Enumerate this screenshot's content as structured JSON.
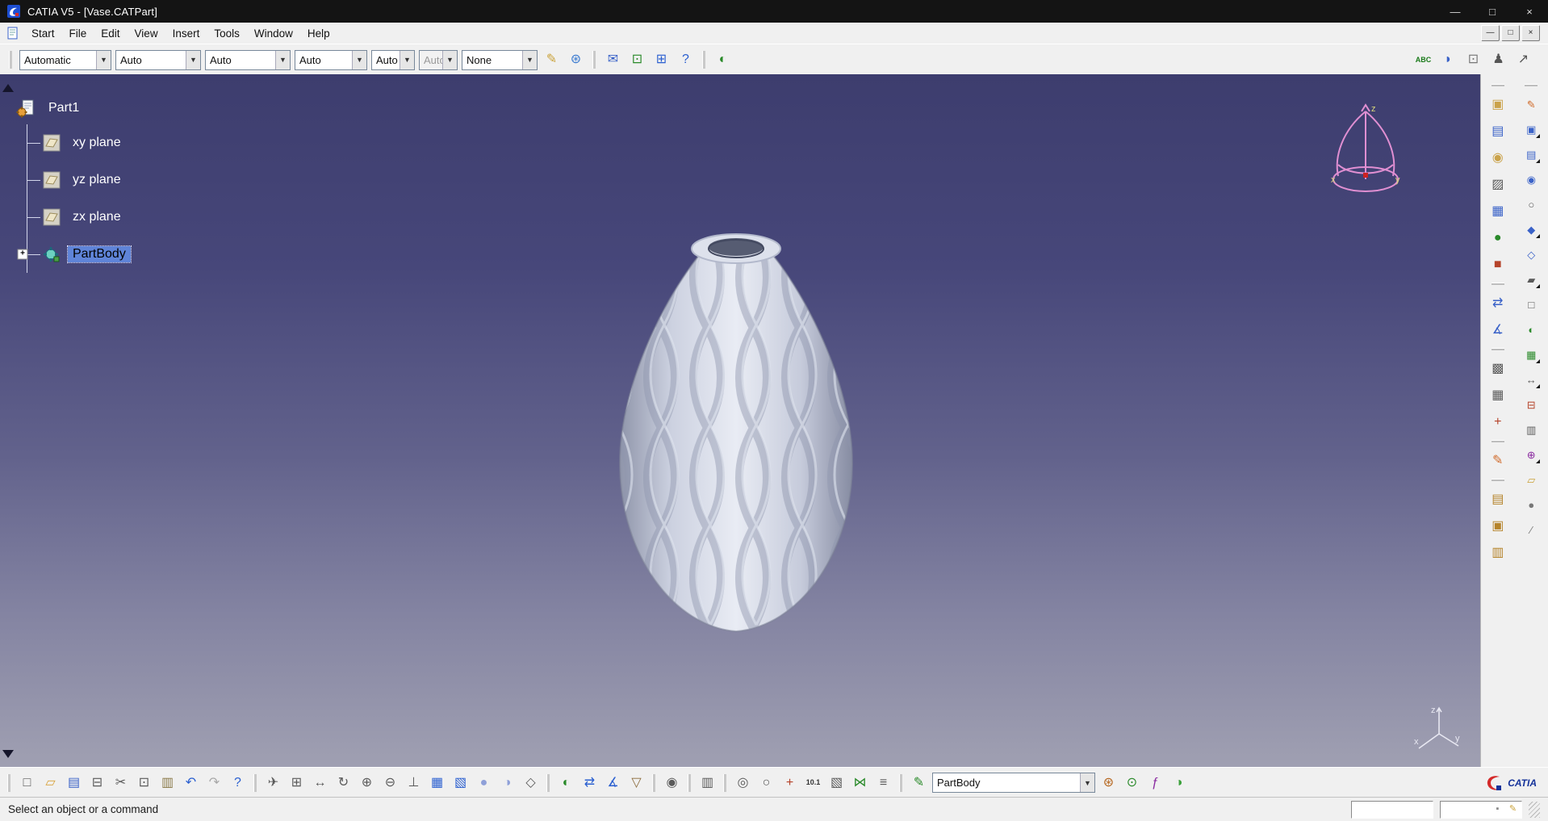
{
  "window": {
    "title": "CATIA V5 - [Vase.CATPart]",
    "controls": [
      {
        "name": "minimize-button",
        "glyph": "—",
        "color": "#dddddd"
      },
      {
        "name": "maximize-button",
        "glyph": "□",
        "color": "#dddddd"
      },
      {
        "name": "close-button",
        "glyph": "×",
        "color": "#dddddd"
      }
    ]
  },
  "menubar": {
    "items": [
      "Start",
      "File",
      "Edit",
      "View",
      "Insert",
      "Tools",
      "Window",
      "Help"
    ],
    "mdi_controls": [
      {
        "name": "mdi-minimize-button",
        "glyph": "—",
        "color": "#222222"
      },
      {
        "name": "mdi-restore-button",
        "glyph": "□",
        "color": "#222222"
      },
      {
        "name": "mdi-close-button",
        "glyph": "×",
        "color": "#222222"
      }
    ]
  },
  "graphic_toolbar": {
    "dropdowns": [
      {
        "name": "color-select",
        "value": "Automatic"
      },
      {
        "name": "transparency-select",
        "value": "Auto"
      },
      {
        "name": "line-weight-select",
        "value": "Auto"
      },
      {
        "name": "line-type-select",
        "value": "Auto"
      },
      {
        "name": "point-symbol-select",
        "value": "Auto"
      },
      {
        "name": "rendering-style-select",
        "value": "Auto",
        "disabled": true
      },
      {
        "name": "layer-select",
        "value": "None"
      }
    ],
    "icons": [
      {
        "name": "painter-icon",
        "glyph": "✎",
        "color": "#caa23a"
      },
      {
        "name": "wizard-icon",
        "glyph": "⊛",
        "color": "#3a7ad0"
      },
      {
        "type": "sep"
      },
      {
        "name": "envelope-icon",
        "glyph": "✉",
        "color": "#3a62c8"
      },
      {
        "name": "link-icon",
        "glyph": "⊡",
        "color": "#2a8a2a"
      },
      {
        "name": "instantiate-icon",
        "glyph": "⊞",
        "color": "#2a5fd0"
      },
      {
        "name": "whats-this-icon",
        "glyph": "?",
        "color": "#2a5fd0"
      },
      {
        "type": "sep"
      },
      {
        "name": "swap-visible-space-icon",
        "glyph": "◐",
        "color": "#2a8a2a"
      }
    ],
    "right_icons": [
      {
        "name": "abc-check-icon",
        "glyph": "ABC",
        "color": "#1a7a1a",
        "cls": "sm"
      },
      {
        "name": "speech-bubble-icon",
        "glyph": "◗",
        "color": "#3a62c8"
      },
      {
        "name": "paste-format-icon",
        "glyph": "⊡",
        "color": "#777777"
      },
      {
        "name": "manikin-icon",
        "glyph": "♟",
        "color": "#555555"
      },
      {
        "name": "pointer-help-icon",
        "glyph": "↗",
        "color": "#555555"
      }
    ]
  },
  "tree": {
    "root_label": "Part1",
    "items": [
      {
        "label": "xy plane"
      },
      {
        "label": "yz plane"
      },
      {
        "label": "zx plane"
      },
      {
        "label": "PartBody",
        "selected": true
      }
    ]
  },
  "viewport": {
    "compass_labels": {
      "z": "z",
      "x": "x",
      "y": "y"
    },
    "triad_labels": {
      "z": "z",
      "x": "x",
      "y": "y"
    }
  },
  "right_toolbar": {
    "main_column": [
      {
        "type": "sep"
      },
      {
        "name": "pad-icon",
        "glyph": "▣",
        "color": "#caa24a"
      },
      {
        "name": "pocket-icon",
        "glyph": "▤",
        "color": "#3a62c8"
      },
      {
        "name": "shaft-icon",
        "glyph": "◉",
        "color": "#caa24a"
      },
      {
        "name": "rib-icon",
        "glyph": "▨",
        "color": "#5a5a5a"
      },
      {
        "name": "multi-sections-icon",
        "glyph": "▦",
        "color": "#3a62c8"
      },
      {
        "name": "sphere-icon",
        "glyph": "●",
        "color": "#2a8a2a"
      },
      {
        "name": "apply-material-icon",
        "glyph": "■",
        "color": "#b5432a"
      },
      {
        "type": "sep"
      },
      {
        "name": "measure-between-icon",
        "glyph": "⇄",
        "color": "#3a62c8"
      },
      {
        "name": "measure-item-icon",
        "glyph": "∡",
        "color": "#3a62c8"
      },
      {
        "type": "sep"
      },
      {
        "name": "pattern-icon",
        "glyph": "▩",
        "color": "#5a5a5a"
      },
      {
        "name": "lattice-icon",
        "glyph": "▦",
        "color": "#5a5a5a"
      },
      {
        "name": "axis-system-icon",
        "glyph": "+",
        "color": "#b5432a"
      },
      {
        "type": "sep"
      },
      {
        "name": "sketch-icon",
        "glyph": "✎",
        "color": "#d06a2a"
      },
      {
        "type": "sep"
      },
      {
        "name": "catalog-icon",
        "glyph": "▤",
        "color": "#b5832a"
      },
      {
        "name": "macros-icon",
        "glyph": "▣",
        "color": "#b5832a"
      },
      {
        "name": "library-icon",
        "glyph": "▥",
        "color": "#b5832a"
      }
    ],
    "edge_column": [
      {
        "type": "sep"
      },
      {
        "name": "sketch-icon",
        "glyph": "✎",
        "color": "#d06a2a"
      },
      {
        "name": "pad-icon",
        "glyph": "▣",
        "color": "#3a62c8",
        "flyout": true
      },
      {
        "name": "pocket-icon",
        "glyph": "▤",
        "color": "#3a62c8",
        "flyout": true
      },
      {
        "name": "shaft-icon",
        "glyph": "◉",
        "color": "#3a62c8"
      },
      {
        "name": "hole-icon",
        "glyph": "○",
        "color": "#5a5a5a"
      },
      {
        "name": "fillet-icon",
        "glyph": "◆",
        "color": "#3a62c8",
        "flyout": true
      },
      {
        "name": "chamfer-icon",
        "glyph": "◇",
        "color": "#3a62c8"
      },
      {
        "name": "draft-icon",
        "glyph": "▰",
        "color": "#5a5a5a",
        "flyout": true
      },
      {
        "name": "shell-icon",
        "glyph": "□",
        "color": "#5a5a5a"
      },
      {
        "name": "mirror-icon",
        "glyph": "◐",
        "color": "#2a8a2a"
      },
      {
        "name": "pattern-icon",
        "glyph": "▦",
        "color": "#2a8a2a",
        "flyout": true
      },
      {
        "name": "translate-icon",
        "glyph": "↔",
        "color": "#5a5a5a",
        "flyout": true
      },
      {
        "name": "split-icon",
        "glyph": "⊟",
        "color": "#b5432a"
      },
      {
        "name": "thickness-icon",
        "glyph": "▥",
        "color": "#5a5a5a"
      },
      {
        "name": "boolean-icon",
        "glyph": "⊕",
        "color": "#8a2aa0",
        "flyout": true
      },
      {
        "name": "plane-icon",
        "glyph": "▱",
        "color": "#caa23a"
      },
      {
        "name": "point-icon",
        "glyph": "●",
        "color": "#777777"
      },
      {
        "name": "line-icon",
        "glyph": "∕",
        "color": "#777777"
      }
    ]
  },
  "bottom_toolbar": {
    "icons": [
      {
        "type": "sep"
      },
      {
        "name": "new-document-icon",
        "glyph": "□",
        "color": "#5a5a5a"
      },
      {
        "name": "open-folder-icon",
        "glyph": "▱",
        "color": "#d9a33c"
      },
      {
        "name": "save-icon",
        "glyph": "▤",
        "color": "#3a62c8"
      },
      {
        "name": "print-icon",
        "glyph": "⊟",
        "color": "#5a5a5a"
      },
      {
        "name": "cut-icon",
        "glyph": "✂",
        "color": "#5a5a5a"
      },
      {
        "name": "copy-icon",
        "glyph": "⊡",
        "color": "#5a5a5a"
      },
      {
        "name": "paste-icon",
        "glyph": "▥",
        "color": "#8a7a4a"
      },
      {
        "name": "undo-icon",
        "glyph": "↶",
        "color": "#2a5fd0"
      },
      {
        "name": "redo-icon",
        "glyph": "↷",
        "color": "#a8a8a8"
      },
      {
        "name": "whats-this-icon",
        "glyph": "?",
        "color": "#2a5fd0"
      },
      {
        "type": "sep"
      },
      {
        "name": "fly-mode-icon",
        "glyph": "✈",
        "color": "#5a5a5a"
      },
      {
        "name": "fit-all-in-icon",
        "glyph": "⊞",
        "color": "#5a5a5a"
      },
      {
        "name": "pan-icon",
        "glyph": "↔",
        "color": "#5a5a5a"
      },
      {
        "name": "rotate-view-icon",
        "glyph": "↻",
        "color": "#5a5a5a"
      },
      {
        "name": "zoom-in-icon",
        "glyph": "⊕",
        "color": "#5a5a5a"
      },
      {
        "name": "zoom-out-icon",
        "glyph": "⊖",
        "color": "#5a5a5a"
      },
      {
        "name": "normal-view-icon",
        "glyph": "⊥",
        "color": "#5a5a5a"
      },
      {
        "name": "multi-view-icon",
        "glyph": "▦",
        "color": "#2a5fd0"
      },
      {
        "name": "iso-view-icon",
        "glyph": "▧",
        "color": "#2a5fd0"
      },
      {
        "name": "shading-icon",
        "glyph": "●",
        "color": "#8fa0d8"
      },
      {
        "name": "shading-edges-icon",
        "glyph": "◑",
        "color": "#8fa0d8"
      },
      {
        "name": "wireframe-icon",
        "glyph": "◇",
        "color": "#5a5a5a"
      },
      {
        "type": "sep"
      },
      {
        "name": "hide-show-icon",
        "glyph": "◐",
        "color": "#2a8a2a"
      },
      {
        "name": "measure-between-icon",
        "glyph": "⇄",
        "color": "#2a5fd0"
      },
      {
        "name": "measure-item-icon",
        "glyph": "∡",
        "color": "#2a5fd0"
      },
      {
        "name": "mass-properties-icon",
        "glyph": "▽",
        "color": "#8a6a3a"
      },
      {
        "type": "sep"
      },
      {
        "name": "camera-icon",
        "glyph": "◉",
        "color": "#5a5a5a"
      },
      {
        "type": "sep"
      },
      {
        "name": "analysis-chart-icon",
        "glyph": "▥",
        "color": "#5a5a5a"
      },
      {
        "type": "sep"
      },
      {
        "name": "turntable-icon",
        "glyph": "◎",
        "color": "#5a5a5a"
      },
      {
        "name": "manipulation-icon",
        "glyph": "○",
        "color": "#5a5a5a"
      },
      {
        "name": "axis-system-icon",
        "glyph": "+",
        "color": "#b5432a"
      },
      {
        "name": "dimension-display-icon",
        "glyph": "10.1",
        "color": "#333333",
        "cls": "sm"
      },
      {
        "name": "bounding-box-icon",
        "glyph": "▧",
        "color": "#5a5a5a"
      },
      {
        "name": "constraints-icon",
        "glyph": "⋈",
        "color": "#2a8a2a"
      },
      {
        "name": "tree-list-icon",
        "glyph": "≡",
        "color": "#5a5a5a"
      },
      {
        "type": "sep"
      },
      {
        "name": "catalog-pen-icon",
        "glyph": "✎",
        "color": "#2a8a2a"
      }
    ],
    "catalog_value": "PartBody",
    "icons_right": [
      {
        "name": "power-copy-icon",
        "glyph": "⊛",
        "color": "#b5651d"
      },
      {
        "name": "search-icon",
        "glyph": "⊙",
        "color": "#2a8a2a"
      },
      {
        "name": "knowledge-formula-icon",
        "glyph": "ƒ",
        "color": "#8a2aa0"
      },
      {
        "name": "apply-material-icon",
        "glyph": "◑",
        "color": "#3aa03a"
      }
    ],
    "brand_text": "CATIA"
  },
  "statusbar": {
    "message": "Select an object or a command",
    "field_icons": [
      {
        "name": "lock-icon",
        "glyph": "▪",
        "color": "#888888"
      },
      {
        "name": "pen-icon",
        "glyph": "✎",
        "color": "#caa23a"
      }
    ]
  },
  "colors": {
    "selection": "#5f84d8",
    "viewport_top": "#3d3d6e",
    "viewport_bottom": "#a0a0b2",
    "compass": "#e08fd2",
    "titlebar": "#141414"
  }
}
